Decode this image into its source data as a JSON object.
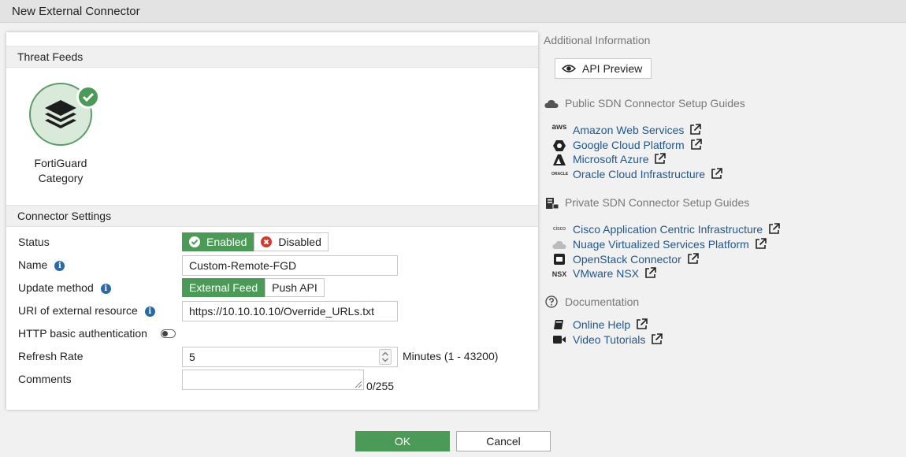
{
  "window": {
    "title": "New External Connector"
  },
  "threat_feeds": {
    "heading": "Threat Feeds",
    "card_label_line1": "FortiGuard",
    "card_label_line2": "Category"
  },
  "connector_settings": {
    "heading": "Connector Settings",
    "status": {
      "label": "Status",
      "enabled": "Enabled",
      "disabled": "Disabled",
      "selected": "Enabled"
    },
    "name": {
      "label": "Name",
      "value": "Custom-Remote-FGD"
    },
    "update_method": {
      "label": "Update method",
      "options": [
        "External Feed",
        "Push API"
      ],
      "selected": "External Feed"
    },
    "uri": {
      "label": "URI of external resource",
      "value": "https://10.10.10.10/Override_URLs.txt"
    },
    "http_auth": {
      "label": "HTTP basic authentication",
      "enabled": false
    },
    "refresh_rate": {
      "label": "Refresh Rate",
      "value": "5",
      "unit": "Minutes (1 - 43200)"
    },
    "comments": {
      "label": "Comments",
      "value": "",
      "counter": "0/255"
    }
  },
  "side": {
    "additional_info": "Additional Information",
    "api_preview": "API Preview",
    "public_heading": "Public SDN Connector Setup Guides",
    "public_links": [
      "Amazon Web Services",
      "Google Cloud Platform",
      "Microsoft Azure",
      "Oracle Cloud Infrastructure"
    ],
    "private_heading": "Private SDN Connector Setup Guides",
    "private_links": [
      "Cisco Application Centric Infrastructure",
      "Nuage Virtualized Services Platform",
      "OpenStack Connector",
      "VMware NSX"
    ],
    "docs_heading": "Documentation",
    "doc_links": [
      "Online Help",
      "Video Tutorials"
    ],
    "icon_labels": {
      "aws": "aws",
      "nsx": "NSX",
      "cisco": "cisco",
      "oracle": "ORACLE"
    }
  },
  "footer": {
    "ok": "OK",
    "cancel": "Cancel"
  },
  "colors": {
    "accent_green": "#4c9a57",
    "link_blue": "#23578c",
    "info_blue": "#2a69a5"
  }
}
